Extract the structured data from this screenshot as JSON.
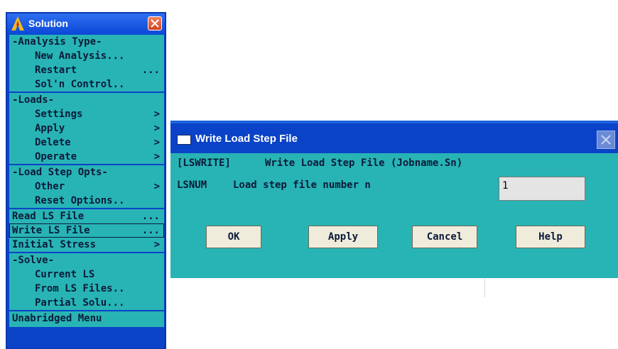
{
  "colors": {
    "menu_bg": "#28b4b4",
    "titlebar": "#0a43c8",
    "text": "#0b1a3a",
    "button_face": "#f0ecdc",
    "close_red": "#d2421a"
  },
  "solution_menu": {
    "title": "Solution",
    "logo_icon": "ansys-logo-icon",
    "close_icon": "close-icon",
    "items": [
      {
        "label": "-Analysis Type-",
        "suffix": ""
      },
      {
        "label": "New Analysis...",
        "suffix": ""
      },
      {
        "label": "Restart",
        "suffix": "..."
      },
      {
        "label": "Sol'n Control..",
        "suffix": ""
      },
      {
        "label": "-Loads-",
        "suffix": ""
      },
      {
        "label": "Settings",
        "suffix": ">"
      },
      {
        "label": "Apply",
        "suffix": ">"
      },
      {
        "label": "Delete",
        "suffix": ">"
      },
      {
        "label": "Operate",
        "suffix": ">"
      },
      {
        "label": "-Load Step Opts-",
        "suffix": ""
      },
      {
        "label": "Other",
        "suffix": ">"
      },
      {
        "label": "Reset Options..",
        "suffix": ""
      },
      {
        "label": "Read LS File",
        "suffix": "..."
      },
      {
        "label": "Write LS File",
        "suffix": "..."
      },
      {
        "label": "Initial Stress",
        "suffix": ">"
      },
      {
        "label": "-Solve-",
        "suffix": ""
      },
      {
        "label": "Current LS",
        "suffix": ""
      },
      {
        "label": "From LS Files..",
        "suffix": ""
      },
      {
        "label": "Partial Solu...",
        "suffix": ""
      },
      {
        "label": "Unabridged Menu",
        "suffix": ""
      }
    ],
    "selected_item": "Write LS File"
  },
  "dialog": {
    "title": "Write Load Step File",
    "icon": "window-icon",
    "command_tag": "[LSWRITE]",
    "command_desc": "Write Load Step File (Jobname.Sn)",
    "field_tag": "LSNUM",
    "field_label": "Load step file number n",
    "field_value": "1",
    "buttons": {
      "ok": "OK",
      "apply": "Apply",
      "cancel": "Cancel",
      "help": "Help"
    }
  }
}
